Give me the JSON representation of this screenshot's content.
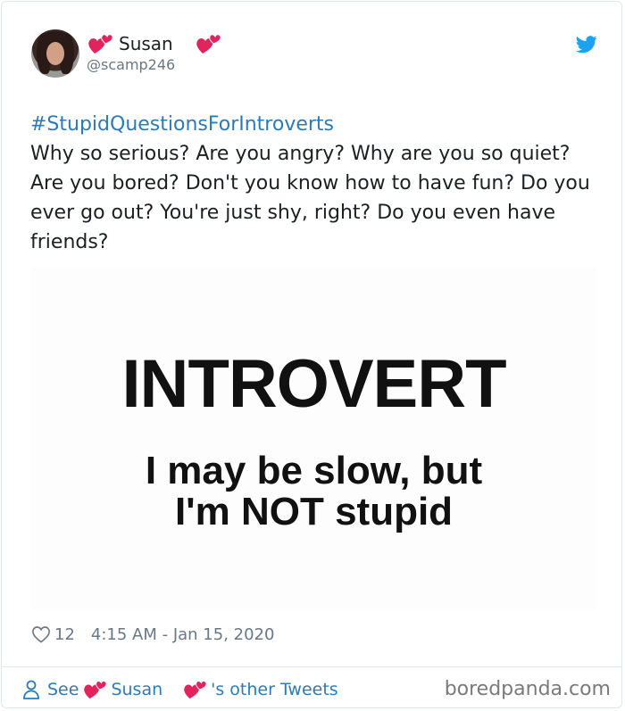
{
  "tweet": {
    "author": {
      "display_name": "Susan",
      "handle": "@scamp246",
      "emoji_icon": "two-hearts-emoji"
    },
    "hashtag": "#StupidQuestionsForIntroverts",
    "text": "Why so serious? Are you angry? Why are you so quiet? Are you bored? Don't you know how to have fun? Do you ever go out? You're just shy, right? Do you even have friends?",
    "media": {
      "title": "INTROVERT",
      "subtitle_line1": "I may be slow, but",
      "subtitle_line2": "I'm NOT stupid"
    },
    "likes": "12",
    "timestamp": "4:15 AM - Jan 15, 2020",
    "footer": {
      "see_label": "See",
      "name": "Susan",
      "other_tweets_label": "'s other Tweets"
    },
    "colors": {
      "link": "#2b7bb9",
      "meta": "#697882",
      "twitter_blue": "#1da1f2",
      "heart_red": "#e0245e"
    }
  },
  "watermark": "boredpanda.com"
}
